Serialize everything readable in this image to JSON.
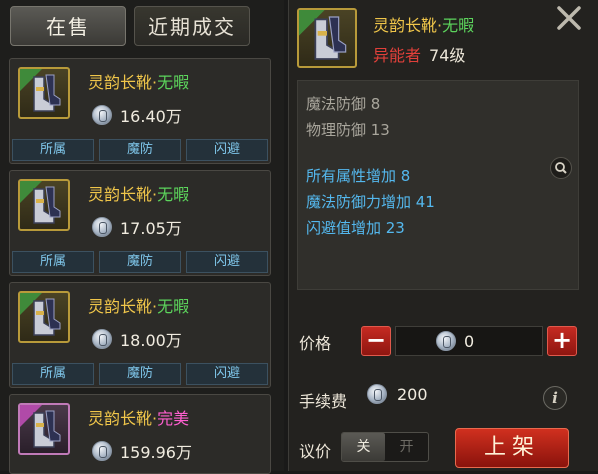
{
  "tabs": {
    "on_sale": "在售",
    "recent": "近期成交"
  },
  "listings": [
    {
      "name": "灵韵长靴",
      "separator": "·",
      "quality": "无暇",
      "quality_color": "#5cd45c",
      "price": "16.40万",
      "attrs": [
        "所属",
        "魔防",
        "闪避"
      ]
    },
    {
      "name": "灵韵长靴",
      "separator": "·",
      "quality": "无暇",
      "quality_color": "#5cd45c",
      "price": "17.05万",
      "attrs": [
        "所属",
        "魔防",
        "闪避"
      ]
    },
    {
      "name": "灵韵长靴",
      "separator": "·",
      "quality": "无暇",
      "quality_color": "#5cd45c",
      "price": "18.00万",
      "attrs": [
        "所属",
        "魔防",
        "闪避"
      ]
    },
    {
      "name": "灵韵长靴",
      "separator": "·",
      "quality": "完美",
      "quality_color": "#ff5fd0",
      "price": "159.96万",
      "attrs": []
    }
  ],
  "detail": {
    "name": "灵韵长靴",
    "separator": "·",
    "quality": "无暇",
    "class": "异能者",
    "level": "74级",
    "base_stats": [
      "魔法防御 8",
      "物理防御 13"
    ],
    "bonus_stats": [
      "所有属性增加 8",
      "魔法防御力增加 41",
      "闪避值增加 23"
    ]
  },
  "form": {
    "price_label": "价格",
    "price_value": "0",
    "fee_label": "手续费",
    "fee_value": "200",
    "bargain_label": "议价",
    "toggle_on": "关",
    "toggle_off": "开",
    "list_button": "上架"
  }
}
